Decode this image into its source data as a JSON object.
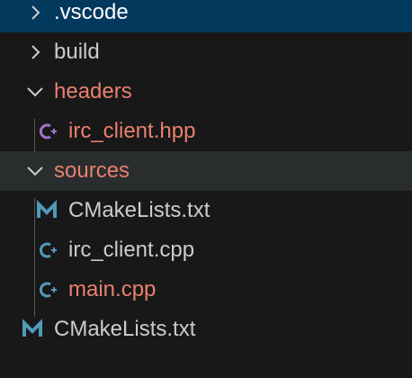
{
  "colors": {
    "background": "#181818",
    "selected_bg": "#04395e",
    "hover_bg": "#2a2d2e",
    "text_default": "#cccccc",
    "text_modified": "#e8806f",
    "cpp_icon": "#519aba",
    "hpp_icon": "#a074c4",
    "cmake_icon": "#519aba"
  },
  "tree": {
    "items": [
      {
        "label": ".vscode",
        "kind": "folder",
        "expanded": false,
        "state": "selected"
      },
      {
        "label": "build",
        "kind": "folder",
        "expanded": false,
        "state": "normal"
      },
      {
        "label": "headers",
        "kind": "folder",
        "expanded": true,
        "state": "modified"
      },
      {
        "label": "irc_client.hpp",
        "kind": "file",
        "icon": "cpp-header-icon",
        "state": "modified"
      },
      {
        "label": "sources",
        "kind": "folder",
        "expanded": true,
        "state": "modified-hover"
      },
      {
        "label": "CMakeLists.txt",
        "kind": "file",
        "icon": "cmake-icon",
        "state": "normal"
      },
      {
        "label": "irc_client.cpp",
        "kind": "file",
        "icon": "cpp-icon",
        "state": "normal"
      },
      {
        "label": "main.cpp",
        "kind": "file",
        "icon": "cpp-icon",
        "state": "modified"
      },
      {
        "label": "CMakeLists.txt",
        "kind": "file",
        "icon": "cmake-icon",
        "state": "normal"
      }
    ]
  }
}
